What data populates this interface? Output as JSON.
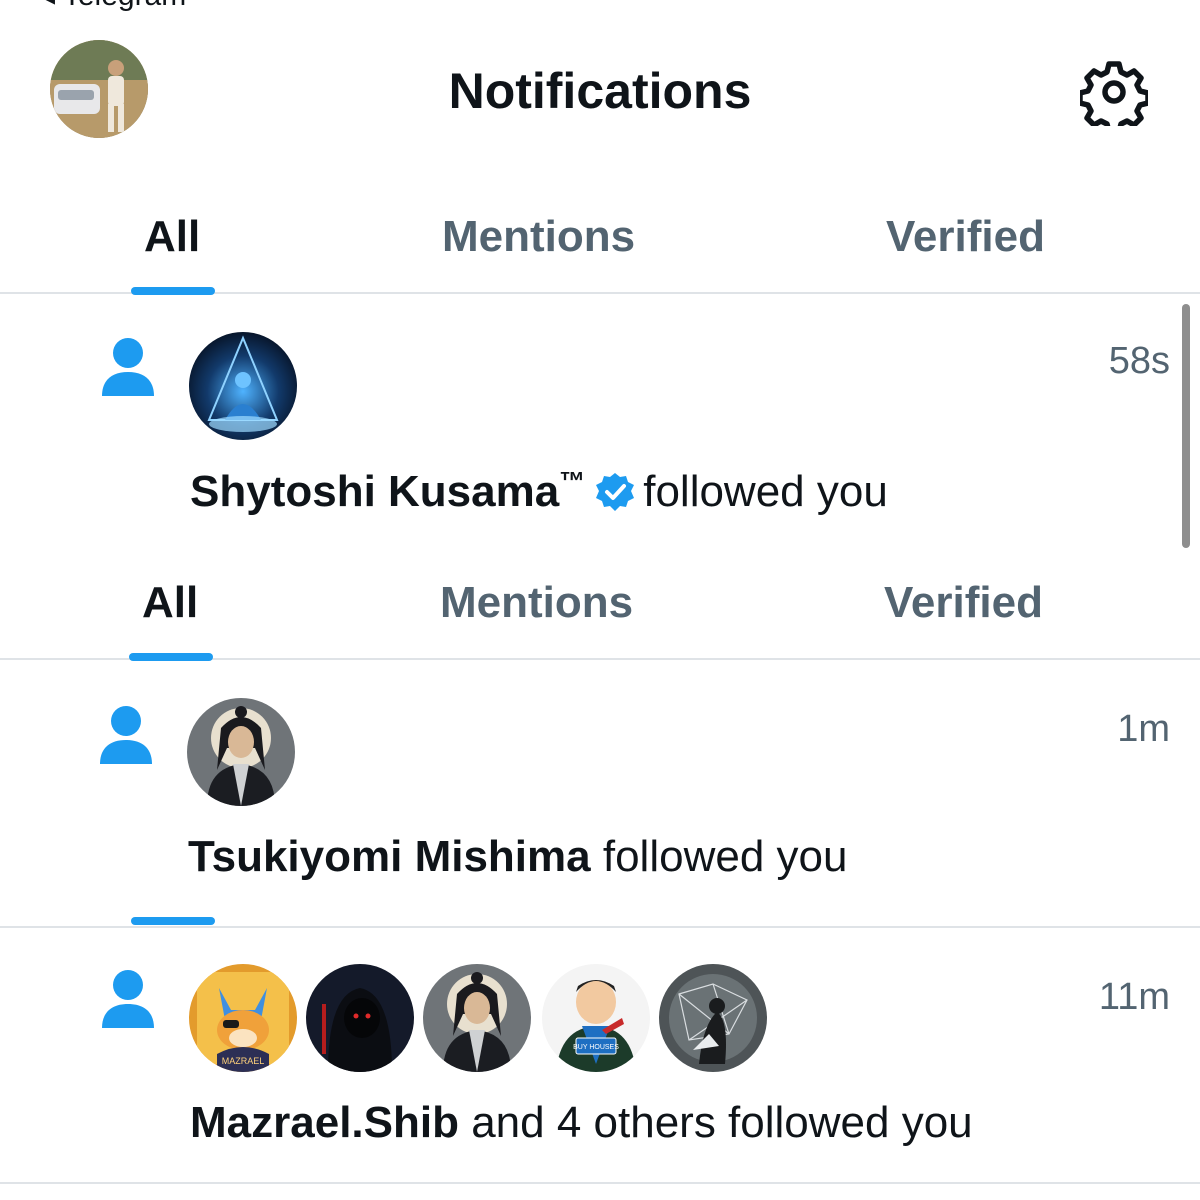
{
  "status_bar": {
    "back_label": "◂ Telegram"
  },
  "header": {
    "title": "Notifications",
    "settings_icon": "gear-icon"
  },
  "tabs": [
    {
      "label": "All",
      "active": true
    },
    {
      "label": "Mentions",
      "active": false
    },
    {
      "label": "Verified",
      "active": false
    }
  ],
  "colors": {
    "accent": "#1d9bf0",
    "secondary_text": "#536471",
    "divider": "#dfe3e7"
  },
  "notifications": [
    {
      "type": "follow",
      "icon": "person-icon",
      "name": "Shytoshi Kusama",
      "name_suffix": "™",
      "verified": true,
      "action": "followed you",
      "time": "58s"
    },
    {
      "type": "follow",
      "icon": "person-icon",
      "name": "Tsukiyomi Mishima",
      "verified": false,
      "action": "followed you",
      "time": "1m"
    },
    {
      "type": "follow",
      "icon": "person-icon",
      "name": "Mazrael.Shib",
      "action": "and 4 others followed you",
      "time": "11m",
      "avatars": [
        "Mazrael.Shib",
        "hooded-figure",
        "Tsukiyomi Mishima",
        "buy-houses-avatar",
        "network-figure"
      ],
      "avatar_labels": {
        "mazrael": "MAZRAEL",
        "buy_houses": "BUY HOUSES"
      }
    }
  ]
}
